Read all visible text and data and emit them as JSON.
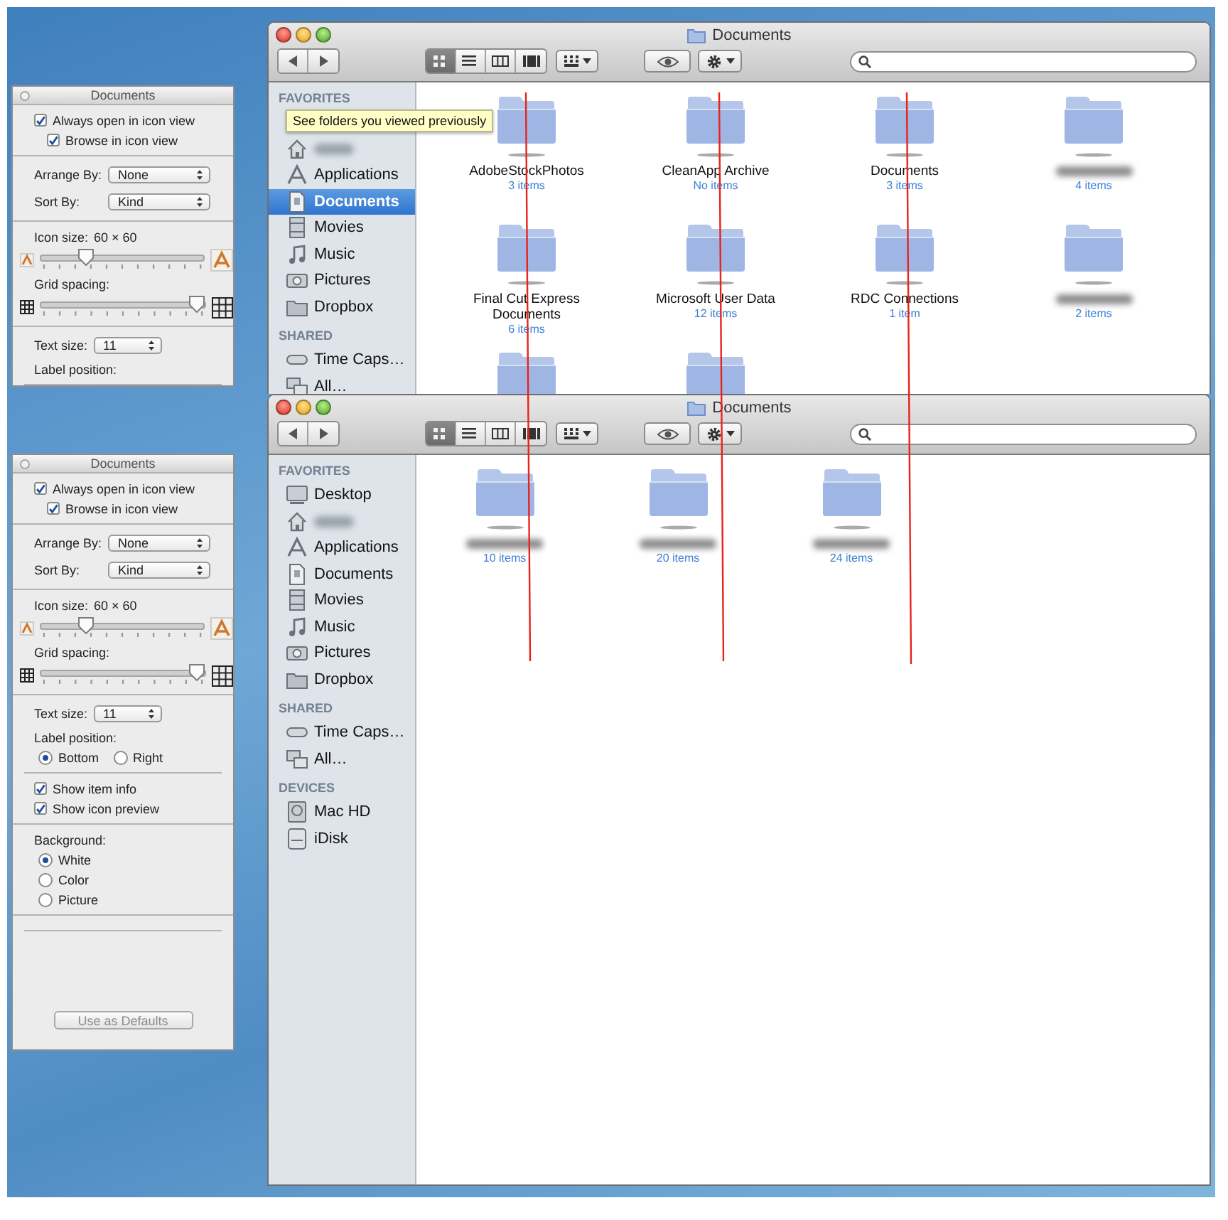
{
  "desktop": {
    "red_guide_lines": true
  },
  "scenes": [
    {
      "options_panel": {
        "title": "Documents",
        "sections": [
          [
            {
              "kind": "checkbox",
              "label": "Always open in icon view",
              "checked": true,
              "children": [
                {
                  "kind": "checkbox",
                  "label": "Browse in icon view",
                  "checked": true
                }
              ]
            }
          ],
          [
            {
              "kind": "popup",
              "label": "Arrange By:",
              "value": "None"
            },
            {
              "kind": "popup",
              "label": "Sort By:",
              "value": "Kind"
            }
          ],
          [
            {
              "kind": "slider",
              "label": "Icon size:",
              "reading": "60 × 60",
              "level": 0.25
            },
            {
              "kind": "slider",
              "label": "Grid spacing:",
              "level": 1
            }
          ],
          [
            {
              "kind": "popup",
              "label": "Text size:",
              "value": "11"
            },
            {
              "kind": "heading",
              "text": "Label position:"
            }
          ]
        ]
      },
      "finder": {
        "title": "Documents",
        "view_modes": [
          {
            "kind": "icons",
            "selected": true
          },
          {
            "kind": "list",
            "selected": false
          },
          {
            "kind": "columns",
            "selected": false
          },
          {
            "kind": "coverflow",
            "selected": false
          }
        ],
        "tooltip": "See folders you viewed previously",
        "sidebar": [
          {
            "heading": "FAVORITES",
            "items": [
              {
                "kind": "home",
                "blurred": true,
                "selected": false
              },
              {
                "kind": "applications",
                "label": "Applications",
                "selected": false
              },
              {
                "kind": "documents",
                "label": "Documents",
                "selected": true
              },
              {
                "kind": "movies",
                "label": "Movies",
                "selected": false
              },
              {
                "kind": "music",
                "label": "Music",
                "selected": false
              },
              {
                "kind": "pictures",
                "label": "Pictures",
                "selected": false
              },
              {
                "kind": "folder",
                "label": "Dropbox",
                "selected": false
              }
            ]
          },
          {
            "heading": "SHARED",
            "items": [
              {
                "kind": "server",
                "label": "Time Caps…",
                "selected": false
              },
              {
                "kind": "network",
                "label": "All…",
                "selected": false
              }
            ]
          }
        ],
        "items": [
          {
            "kind": "named",
            "name": "AdobeStockPhotos",
            "info": "3 items"
          },
          {
            "kind": "named",
            "name": "CleanApp Archive",
            "info": "No items"
          },
          {
            "kind": "named",
            "name": "Documents",
            "info": "3 items"
          },
          {
            "kind": "blurred",
            "info": "4 items"
          },
          {
            "kind": "named",
            "name": "Final Cut Express Documents",
            "info": "6 items"
          },
          {
            "kind": "named",
            "name": "Microsoft User Data",
            "info": "12 items"
          },
          {
            "kind": "named",
            "name": "RDC Connections",
            "info": "1 item"
          },
          {
            "kind": "blurred",
            "info": "2 items"
          },
          {
            "kind": "cut"
          },
          {
            "kind": "cut"
          }
        ]
      }
    },
    {
      "options_panel": {
        "title": "Documents",
        "sections": [
          [
            {
              "kind": "checkbox",
              "label": "Always open in icon view",
              "checked": true,
              "children": [
                {
                  "kind": "checkbox",
                  "label": "Browse in icon view",
                  "checked": true
                }
              ]
            }
          ],
          [
            {
              "kind": "popup",
              "label": "Arrange By:",
              "value": "None"
            },
            {
              "kind": "popup",
              "label": "Sort By:",
              "value": "Kind"
            }
          ],
          [
            {
              "kind": "slider",
              "label": "Icon size:",
              "reading": "60 × 60",
              "level": 0.25
            },
            {
              "kind": "slider",
              "label": "Grid spacing:",
              "level": 1
            }
          ],
          [
            {
              "kind": "popup",
              "label": "Text size:",
              "value": "11"
            },
            {
              "kind": "heading",
              "text": "Label position:"
            },
            {
              "kind": "radio_row",
              "options": [
                {
                  "label": "Bottom",
                  "selected": true
                },
                {
                  "label": "Right",
                  "selected": false
                }
              ]
            }
          ],
          [
            {
              "kind": "checkbox",
              "label": "Show item info",
              "checked": true
            },
            {
              "kind": "checkbox",
              "label": "Show icon preview",
              "checked": true
            }
          ],
          [
            {
              "kind": "heading",
              "text": "Background:"
            },
            {
              "kind": "radio_column",
              "options": [
                {
                  "label": "White",
                  "selected": true
                },
                {
                  "label": "Color",
                  "selected": false
                },
                {
                  "label": "Picture",
                  "selected": false
                }
              ]
            }
          ]
        ],
        "button": {
          "label": "Use as Defaults",
          "disabled": true
        }
      },
      "finder": {
        "title": "Documents",
        "view_modes": [
          {
            "kind": "icons",
            "selected": true
          },
          {
            "kind": "list",
            "selected": false
          },
          {
            "kind": "columns",
            "selected": false
          },
          {
            "kind": "coverflow",
            "selected": false
          }
        ],
        "sidebar": [
          {
            "heading": "FAVORITES",
            "items": [
              {
                "kind": "desktop",
                "label": "Desktop",
                "selected": false
              },
              {
                "kind": "home",
                "blurred": true,
                "selected": false
              },
              {
                "kind": "applications",
                "label": "Applications",
                "selected": false
              },
              {
                "kind": "documents",
                "label": "Documents",
                "selected": false
              },
              {
                "kind": "movies",
                "label": "Movies",
                "selected": false
              },
              {
                "kind": "music",
                "label": "Music",
                "selected": false
              },
              {
                "kind": "pictures",
                "label": "Pictures",
                "selected": false
              },
              {
                "kind": "folder",
                "label": "Dropbox",
                "selected": false
              }
            ]
          },
          {
            "heading": "SHARED",
            "items": [
              {
                "kind": "server",
                "label": "Time Caps…",
                "selected": false
              },
              {
                "kind": "network",
                "label": "All…",
                "selected": false
              }
            ]
          },
          {
            "heading": "DEVICES",
            "items": [
              {
                "kind": "harddisk",
                "label": "Mac HD",
                "selected": false
              },
              {
                "kind": "idisk",
                "label": "iDisk",
                "selected": false
              }
            ]
          }
        ],
        "items": [
          {
            "kind": "blurred",
            "info": "10 items"
          },
          {
            "kind": "blurred",
            "info": "20 items"
          },
          {
            "kind": "blurred",
            "info": "24 items"
          }
        ]
      }
    }
  ]
}
